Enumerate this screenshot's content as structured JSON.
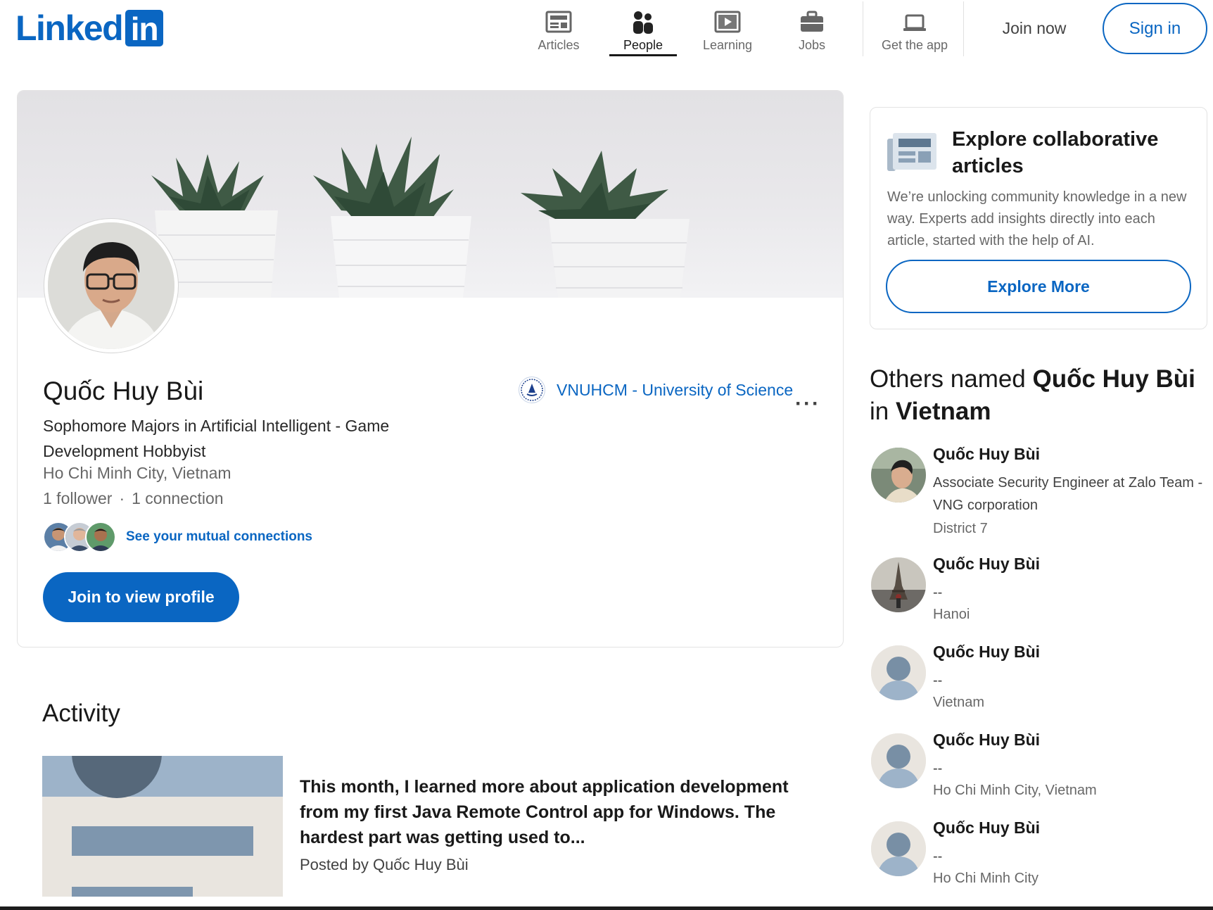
{
  "header": {
    "logo_text": "Linked",
    "logo_box": "in",
    "nav": [
      {
        "label": "Articles",
        "icon": "articles-icon"
      },
      {
        "label": "People",
        "icon": "people-icon",
        "active": true
      },
      {
        "label": "Learning",
        "icon": "learning-icon"
      },
      {
        "label": "Jobs",
        "icon": "jobs-icon"
      },
      {
        "label": "Get the app",
        "icon": "get-app-icon"
      }
    ],
    "join_now": "Join now",
    "sign_in": "Sign in"
  },
  "profile": {
    "name": "Quốc Huy Bùi",
    "headline": "Sophomore Majors in Artificial Intelligent - Game Development Hobbyist",
    "location": "Ho Chi Minh City, Vietnam",
    "followers": "1 follower",
    "separator": "·",
    "connections": "1 connection",
    "mutual_link": "See your mutual connections",
    "join_button": "Join to view profile",
    "school": "VNUHCM - University of Science",
    "more": "···"
  },
  "activity": {
    "title": "Activity",
    "post_text": "This month, I learned more about application development from my first Java Remote Control app for Windows. The hardest part was getting used to...",
    "posted_by": "Posted by Quốc Huy Bùi"
  },
  "explore": {
    "title": "Explore collaborative articles",
    "description": "We’re unlocking community knowledge in a new way. Experts add insights directly into each article, started with the help of AI.",
    "button": "Explore More"
  },
  "others": {
    "title_prefix": "Others named ",
    "title_name": "Quốc Huy Bùi",
    "title_mid": " in ",
    "title_place": "Vietnam",
    "people": [
      {
        "name": "Quốc Huy Bùi",
        "headline": "Associate Security Engineer at Zalo Team - VNG corporation",
        "location": "District 7"
      },
      {
        "name": "Quốc Huy Bùi",
        "headline": "--",
        "location": "Hanoi"
      },
      {
        "name": "Quốc Huy Bùi",
        "headline": "--",
        "location": "Vietnam"
      },
      {
        "name": "Quốc Huy Bùi",
        "headline": "--",
        "location": "Ho Chi Minh City, Vietnam"
      },
      {
        "name": "Quốc Huy Bùi",
        "headline": "--",
        "location": "Ho Chi Minh City"
      }
    ]
  },
  "colors": {
    "brand": "#0a66c2",
    "text": "#191919",
    "muted": "#666666"
  }
}
